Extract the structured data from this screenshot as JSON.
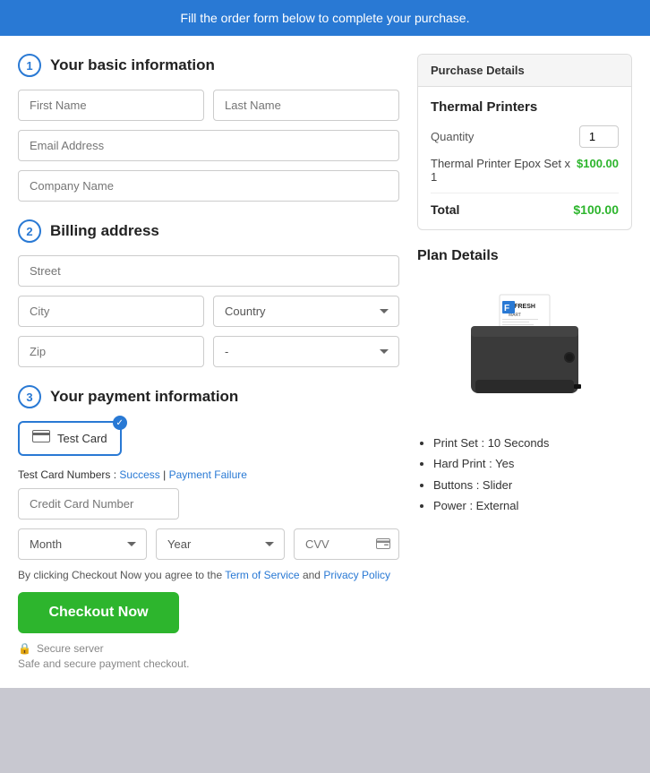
{
  "banner": {
    "text": "Fill the order form below to complete your purchase."
  },
  "form": {
    "step1": {
      "number": "1",
      "title": "Your basic information",
      "first_name_placeholder": "First Name",
      "last_name_placeholder": "Last Name",
      "email_placeholder": "Email Address",
      "company_placeholder": "Company Name"
    },
    "step2": {
      "number": "2",
      "title": "Billing address",
      "street_placeholder": "Street",
      "city_placeholder": "City",
      "country_placeholder": "Country",
      "zip_placeholder": "Zip",
      "state_placeholder": "-"
    },
    "step3": {
      "number": "3",
      "title": "Your payment information",
      "card_option_label": "Test Card",
      "test_card_label": "Test Card Numbers :",
      "test_card_success": "Success",
      "test_card_separator": "|",
      "test_card_failure": "Payment Failure",
      "cc_placeholder": "Credit Card Number",
      "month_placeholder": "Month",
      "year_placeholder": "Year",
      "cvv_placeholder": "CVV",
      "agreement_prefix": "By clicking Checkout Now you agree to the",
      "tos_link": "Term of Service",
      "agreement_and": "and",
      "privacy_link": "Privacy Policy",
      "checkout_btn": "Checkout Now",
      "secure_label": "Secure server",
      "secure_note": "Safe and secure payment checkout."
    }
  },
  "sidebar": {
    "purchase_details": {
      "header": "Purchase Details",
      "product_name": "Thermal Printers",
      "quantity_label": "Quantity",
      "quantity_value": "1",
      "line_item_name": "Thermal Printer Epox Set x 1",
      "line_item_price": "$100.00",
      "total_label": "Total",
      "total_price": "$100.00"
    },
    "plan_details": {
      "title": "Plan Details",
      "features": [
        "Print Set : 10 Seconds",
        "Hard Print : Yes",
        "Buttons : Slider",
        "Power : External"
      ]
    }
  }
}
